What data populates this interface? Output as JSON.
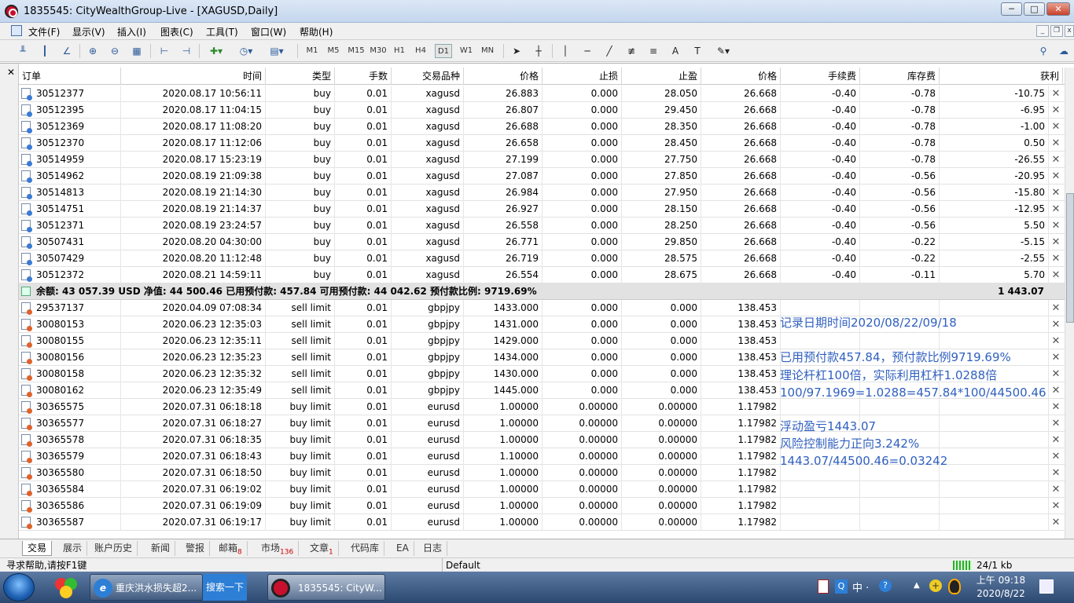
{
  "window": {
    "title": "1835545: CityWealthGroup-Live - [XAGUSD,Daily]"
  },
  "menu": [
    "文件(F)",
    "显示(V)",
    "插入(I)",
    "图表(C)",
    "工具(T)",
    "窗口(W)",
    "帮助(H)"
  ],
  "timeframes": [
    "M1",
    "M5",
    "M15",
    "M30",
    "H1",
    "H4",
    "D1",
    "W1",
    "MN"
  ],
  "active_timeframe": "D1",
  "columns": [
    "订单",
    "时间",
    "类型",
    "手数",
    "交易品种",
    "价格",
    "止损",
    "止盈",
    "价格",
    "手续费",
    "库存费",
    "获利"
  ],
  "open_orders": [
    [
      "30512377",
      "2020.08.17 10:56:11",
      "buy",
      "0.01",
      "xagusd",
      "26.883",
      "0.000",
      "28.050",
      "26.668",
      "-0.40",
      "-0.78",
      "-10.75"
    ],
    [
      "30512395",
      "2020.08.17 11:04:15",
      "buy",
      "0.01",
      "xagusd",
      "26.807",
      "0.000",
      "29.450",
      "26.668",
      "-0.40",
      "-0.78",
      "-6.95"
    ],
    [
      "30512369",
      "2020.08.17 11:08:20",
      "buy",
      "0.01",
      "xagusd",
      "26.688",
      "0.000",
      "28.350",
      "26.668",
      "-0.40",
      "-0.78",
      "-1.00"
    ],
    [
      "30512370",
      "2020.08.17 11:12:06",
      "buy",
      "0.01",
      "xagusd",
      "26.658",
      "0.000",
      "28.450",
      "26.668",
      "-0.40",
      "-0.78",
      "0.50"
    ],
    [
      "30514959",
      "2020.08.17 15:23:19",
      "buy",
      "0.01",
      "xagusd",
      "27.199",
      "0.000",
      "27.750",
      "26.668",
      "-0.40",
      "-0.78",
      "-26.55"
    ],
    [
      "30514962",
      "2020.08.19 21:09:38",
      "buy",
      "0.01",
      "xagusd",
      "27.087",
      "0.000",
      "27.850",
      "26.668",
      "-0.40",
      "-0.56",
      "-20.95"
    ],
    [
      "30514813",
      "2020.08.19 21:14:30",
      "buy",
      "0.01",
      "xagusd",
      "26.984",
      "0.000",
      "27.950",
      "26.668",
      "-0.40",
      "-0.56",
      "-15.80"
    ],
    [
      "30514751",
      "2020.08.19 21:14:37",
      "buy",
      "0.01",
      "xagusd",
      "26.927",
      "0.000",
      "28.150",
      "26.668",
      "-0.40",
      "-0.56",
      "-12.95"
    ],
    [
      "30512371",
      "2020.08.19 23:24:57",
      "buy",
      "0.01",
      "xagusd",
      "26.558",
      "0.000",
      "28.250",
      "26.668",
      "-0.40",
      "-0.56",
      "5.50"
    ],
    [
      "30507431",
      "2020.08.20 04:30:00",
      "buy",
      "0.01",
      "xagusd",
      "26.771",
      "0.000",
      "29.850",
      "26.668",
      "-0.40",
      "-0.22",
      "-5.15"
    ],
    [
      "30507429",
      "2020.08.20 11:12:48",
      "buy",
      "0.01",
      "xagusd",
      "26.719",
      "0.000",
      "28.575",
      "26.668",
      "-0.40",
      "-0.22",
      "-2.55"
    ],
    [
      "30512372",
      "2020.08.21 14:59:11",
      "buy",
      "0.01",
      "xagusd",
      "26.554",
      "0.000",
      "28.675",
      "26.668",
      "-0.40",
      "-0.11",
      "5.70"
    ]
  ],
  "summary": {
    "text": "余额: 43 057.39 USD  净值: 44 500.46  已用预付款: 457.84  可用预付款: 44 042.62  预付款比例: 9719.69%",
    "total": "1 443.07"
  },
  "pending_orders": [
    [
      "29537137",
      "2020.04.09 07:08:34",
      "sell limit",
      "0.01",
      "gbpjpy",
      "1433.000",
      "0.000",
      "0.000",
      "138.453"
    ],
    [
      "30080153",
      "2020.06.23 12:35:03",
      "sell limit",
      "0.01",
      "gbpjpy",
      "1431.000",
      "0.000",
      "0.000",
      "138.453"
    ],
    [
      "30080155",
      "2020.06.23 12:35:11",
      "sell limit",
      "0.01",
      "gbpjpy",
      "1429.000",
      "0.000",
      "0.000",
      "138.453"
    ],
    [
      "30080156",
      "2020.06.23 12:35:23",
      "sell limit",
      "0.01",
      "gbpjpy",
      "1434.000",
      "0.000",
      "0.000",
      "138.453"
    ],
    [
      "30080158",
      "2020.06.23 12:35:32",
      "sell limit",
      "0.01",
      "gbpjpy",
      "1430.000",
      "0.000",
      "0.000",
      "138.453"
    ],
    [
      "30080162",
      "2020.06.23 12:35:49",
      "sell limit",
      "0.01",
      "gbpjpy",
      "1445.000",
      "0.000",
      "0.000",
      "138.453"
    ],
    [
      "30365575",
      "2020.07.31 06:18:18",
      "buy limit",
      "0.01",
      "eurusd",
      "1.00000",
      "0.00000",
      "0.00000",
      "1.17982"
    ],
    [
      "30365577",
      "2020.07.31 06:18:27",
      "buy limit",
      "0.01",
      "eurusd",
      "1.00000",
      "0.00000",
      "0.00000",
      "1.17982"
    ],
    [
      "30365578",
      "2020.07.31 06:18:35",
      "buy limit",
      "0.01",
      "eurusd",
      "1.00000",
      "0.00000",
      "0.00000",
      "1.17982"
    ],
    [
      "30365579",
      "2020.07.31 06:18:43",
      "buy limit",
      "0.01",
      "eurusd",
      "1.10000",
      "0.00000",
      "0.00000",
      "1.17982"
    ],
    [
      "30365580",
      "2020.07.31 06:18:50",
      "buy limit",
      "0.01",
      "eurusd",
      "1.00000",
      "0.00000",
      "0.00000",
      "1.17982"
    ],
    [
      "30365584",
      "2020.07.31 06:19:02",
      "buy limit",
      "0.01",
      "eurusd",
      "1.00000",
      "0.00000",
      "0.00000",
      "1.17982"
    ],
    [
      "30365586",
      "2020.07.31 06:19:09",
      "buy limit",
      "0.01",
      "eurusd",
      "1.00000",
      "0.00000",
      "0.00000",
      "1.17982"
    ],
    [
      "30365587",
      "2020.07.31 06:19:17",
      "buy limit",
      "0.01",
      "eurusd",
      "1.00000",
      "0.00000",
      "0.00000",
      "1.17982"
    ]
  ],
  "annotations": [
    "记录日期时间2020/08/22/09/18",
    "已用预付款457.84，预付款比例9719.69%",
    "理论杆杠100倍，实际利用杠杆1.0288倍",
    "100/97.1969=1.0288=457.84*100/44500.46",
    "浮动盈亏1443.07",
    "风险控制能力正向3.242%",
    "1443.07/44500.46=0.03242"
  ],
  "tabs": [
    {
      "label": "交易",
      "badge": ""
    },
    {
      "label": "展示",
      "badge": ""
    },
    {
      "label": "账户历史",
      "badge": ""
    },
    {
      "label": "新闻",
      "badge": ""
    },
    {
      "label": "警报",
      "badge": ""
    },
    {
      "label": "邮箱",
      "badge": "8"
    },
    {
      "label": "市场",
      "badge": "136"
    },
    {
      "label": "文章",
      "badge": "1"
    },
    {
      "label": "代码库",
      "badge": ""
    },
    {
      "label": "EA",
      "badge": ""
    },
    {
      "label": "日志",
      "badge": ""
    }
  ],
  "status": {
    "help": "寻求帮助,请按F1键",
    "profile": "Default",
    "traffic": "24/1 kb"
  },
  "taskbar": {
    "ie_label": "重庆洪水损失超2...",
    "search_label": "搜索一下",
    "mt_label": "1835545: CityW...",
    "time": "上午 09:18",
    "date": "2020/8/22"
  }
}
